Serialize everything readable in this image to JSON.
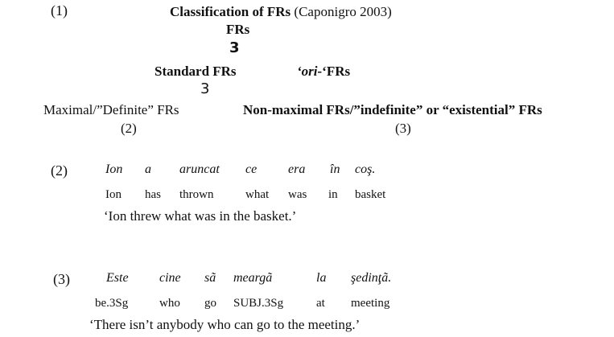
{
  "example1": {
    "number": "(1)",
    "title_bold": "Classification of FRs",
    "title_cite": "(Caponigro 2003)",
    "root": "FRs",
    "root_branch": "3",
    "standard": "Standard FRs",
    "ori_prefix": "‘ori-",
    "ori_suffix": "‘FRs",
    "standard_branch": "3",
    "maximal": "Maximal/”Definite” FRs",
    "maximal_ref": "(2)",
    "nonmaximal": "Non-maximal FRs/”indefinite” or “existential” FRs",
    "nonmaximal_ref": "(3)"
  },
  "example2": {
    "number": "(2)",
    "words": [
      "Ion",
      "a",
      "aruncat",
      "ce",
      "era",
      "în",
      "coş."
    ],
    "gloss": [
      "Ion",
      "has",
      "thrown",
      "what",
      "was",
      "in",
      "basket"
    ],
    "translation": "‘Ion threw what was in the basket.’"
  },
  "example3": {
    "number": "(3)",
    "words": [
      "Este",
      "cine",
      "sã",
      "meargã",
      "la",
      "şedinţã."
    ],
    "gloss": [
      "be.3Sg",
      "who",
      "go",
      "SUBJ.3Sg",
      "at",
      "meeting"
    ],
    "translation": "‘There isn’t anybody who can go to the meeting.’"
  }
}
